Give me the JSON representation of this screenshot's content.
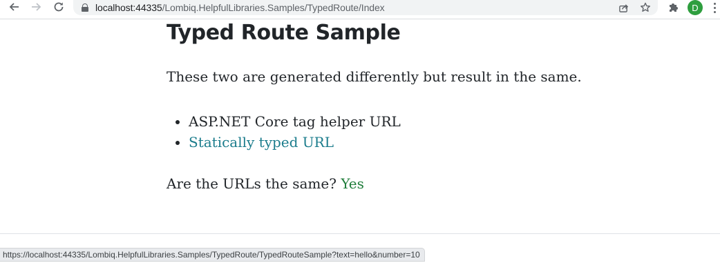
{
  "browser": {
    "url_host": "localhost:44335",
    "url_path": "/Lombiq.HelpfulLibraries.Samples/TypedRoute/Index",
    "back_icon": "arrow-left-icon",
    "forward_icon": "arrow-right-icon",
    "reload_icon": "reload-icon",
    "avatar_letter": "D",
    "avatar_color": "#2e9e3e"
  },
  "page": {
    "title": "Typed Route Sample",
    "intro": "These two are generated differently but result in the same.",
    "links": [
      {
        "text": "ASP.NET Core tag helper URL",
        "is_link": false
      },
      {
        "text": "Statically typed URL",
        "is_link": true
      }
    ],
    "question": "Are the URLs the same?",
    "answer": "Yes",
    "link_color": "#1b7c8c",
    "answer_color": "#1f7d3a"
  },
  "status_bar": {
    "hover_url": "https://localhost:44335/Lombiq.HelpfulLibraries.Samples/TypedRoute/TypedRouteSample?text=hello&number=10"
  }
}
